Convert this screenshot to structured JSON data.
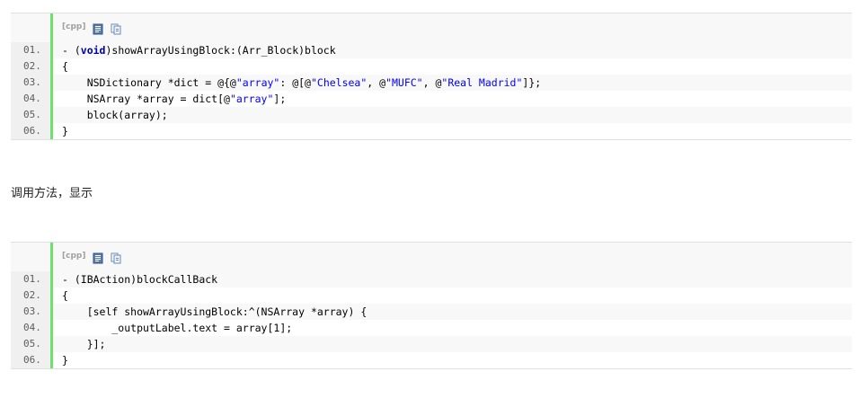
{
  "block1": {
    "lang_label": "[cpp]",
    "icons": [
      "view-plain-icon",
      "copy-icon"
    ],
    "lines": [
      {
        "num": "01.",
        "parts": [
          {
            "t": "- ("
          },
          {
            "t": "void",
            "c": "kw"
          },
          {
            "t": ")showArrayUsingBlock:(Arr_Block)block"
          }
        ]
      },
      {
        "num": "02.",
        "parts": [
          {
            "t": "{"
          }
        ]
      },
      {
        "num": "03.",
        "parts": [
          {
            "t": "    NSDictionary *dict = @{@"
          },
          {
            "t": "\"array\"",
            "c": "str"
          },
          {
            "t": ": @[@"
          },
          {
            "t": "\"Chelsea\"",
            "c": "str"
          },
          {
            "t": ", @"
          },
          {
            "t": "\"MUFC\"",
            "c": "str"
          },
          {
            "t": ", @"
          },
          {
            "t": "\"Real Madrid\"",
            "c": "str"
          },
          {
            "t": "]};"
          }
        ]
      },
      {
        "num": "04.",
        "parts": [
          {
            "t": "    NSArray *array = dict[@"
          },
          {
            "t": "\"array\"",
            "c": "str"
          },
          {
            "t": "];"
          }
        ]
      },
      {
        "num": "05.",
        "parts": [
          {
            "t": "    block(array);"
          }
        ]
      },
      {
        "num": "06.",
        "parts": [
          {
            "t": "}"
          }
        ]
      }
    ]
  },
  "paragraph": "调用方法，显示",
  "block2": {
    "lang_label": "[cpp]",
    "icons": [
      "view-plain-icon",
      "copy-icon"
    ],
    "lines": [
      {
        "num": "01.",
        "parts": [
          {
            "t": "- (IBAction)blockCallBack"
          }
        ]
      },
      {
        "num": "02.",
        "parts": [
          {
            "t": "{"
          }
        ]
      },
      {
        "num": "03.",
        "parts": [
          {
            "t": "    [self showArrayUsingBlock:^(NSArray *array) {"
          }
        ]
      },
      {
        "num": "04.",
        "parts": [
          {
            "t": "        _outputLabel.text = array[1];"
          }
        ]
      },
      {
        "num": "05.",
        "parts": [
          {
            "t": "    }];"
          }
        ]
      },
      {
        "num": "06.",
        "parts": [
          {
            "t": "}"
          }
        ]
      }
    ]
  },
  "colors": {
    "gutter_bar": "#6ce26c",
    "keyword": "#0000aa",
    "string": "#0000ff",
    "line_number": "#5c5c5c"
  }
}
